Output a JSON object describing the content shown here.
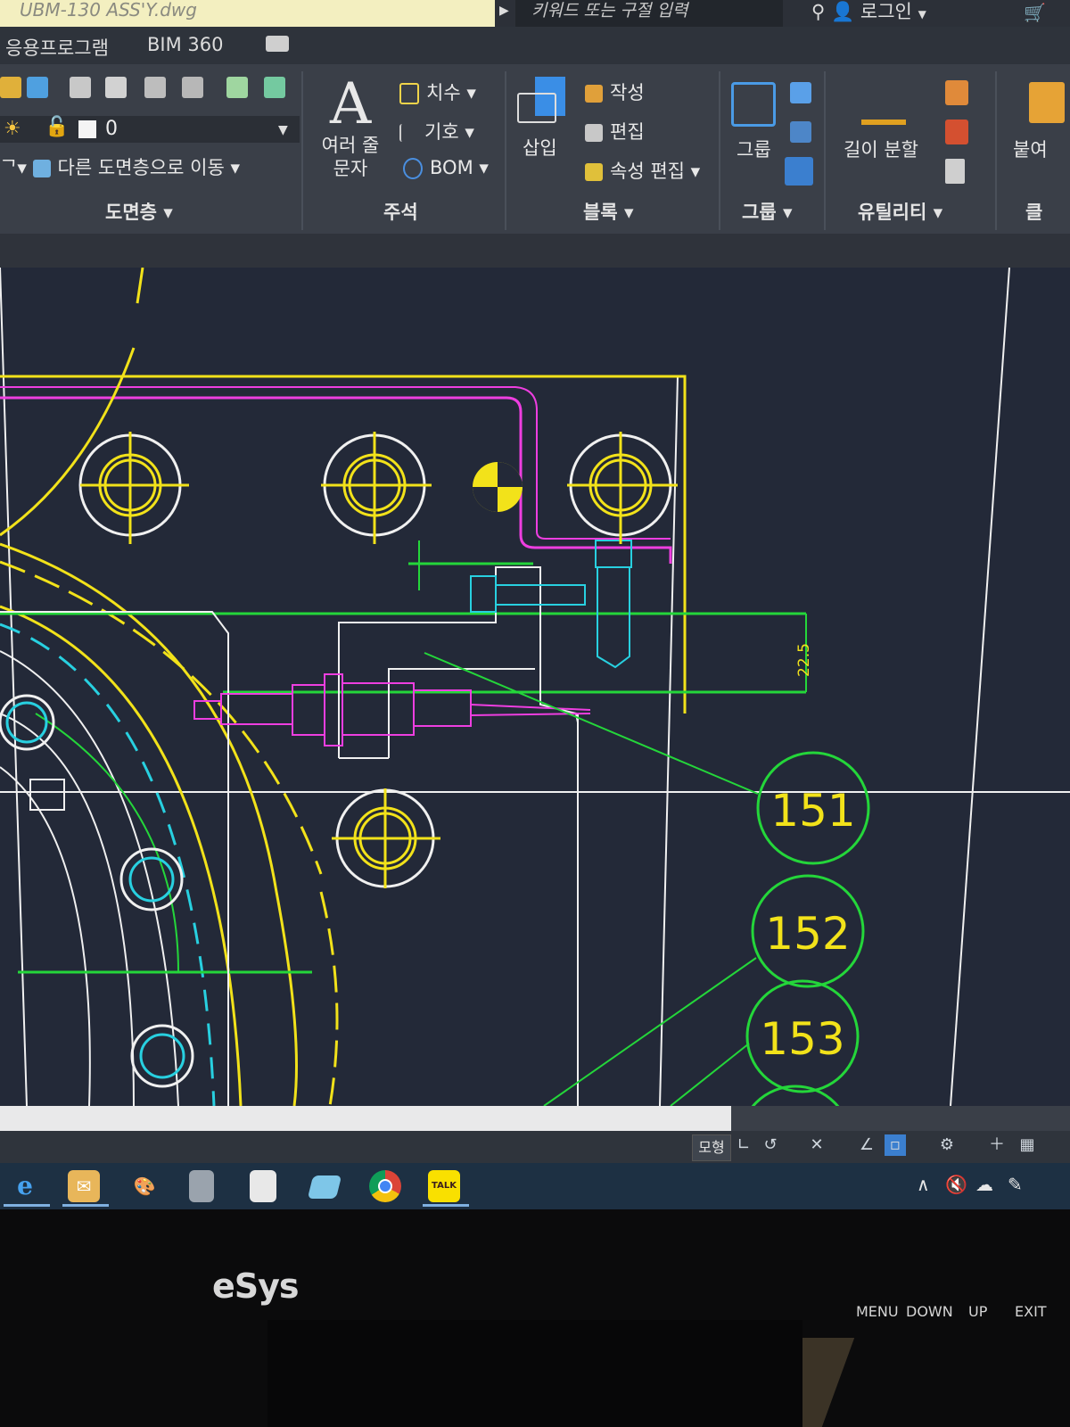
{
  "titlebar": {
    "file_name": "UBM-130 ASS'Y.dwg",
    "search_placeholder": "키워드 또는 구절 입력",
    "login_label": "로그인"
  },
  "ribbon_tabs": [
    "응용프로그램",
    "BIM 360"
  ],
  "ribbon": {
    "layers": {
      "current_layer": "0",
      "move_to_layer": "다른 도면층으로 이동",
      "panel_label": "도면층"
    },
    "annotation": {
      "mtext_label_line1": "여러 줄",
      "mtext_label_line2": "문자",
      "dimension": "치수",
      "leader": "기호",
      "bom": "BOM",
      "panel_label": "주석"
    },
    "block": {
      "insert": "삽입",
      "create": "작성",
      "edit": "편집",
      "attr_edit": "속성 편집",
      "panel_label": "블록"
    },
    "group": {
      "group": "그룹",
      "panel_label": "그룹"
    },
    "utilities": {
      "divide": "길이 분할",
      "panel_label": "유틸리티"
    },
    "clipboard": {
      "paste": "붙여",
      "panel_label": "클"
    }
  },
  "drawing": {
    "dimension_value": "22.5",
    "balloons": [
      "151",
      "152",
      "153"
    ],
    "colors": {
      "background": "#232938",
      "yellow": "#f2e21a",
      "magenta": "#ee3ee0",
      "green": "#24d63a",
      "cyan": "#28d0e0",
      "white": "#f0f0f0"
    }
  },
  "statusbar": {
    "model_label": "모형"
  },
  "taskbar": {
    "apps": [
      "internet-explorer-icon",
      "mail-icon",
      "paint-icon",
      "calculator-icon",
      "notepad-icon",
      "files-icon",
      "chrome-icon",
      "kakaotalk-icon"
    ],
    "kakao_label": "TALK"
  },
  "monitor": {
    "brand": "eSys",
    "buttons": [
      "MENU",
      "DOWN",
      "UP",
      "EXIT"
    ]
  }
}
